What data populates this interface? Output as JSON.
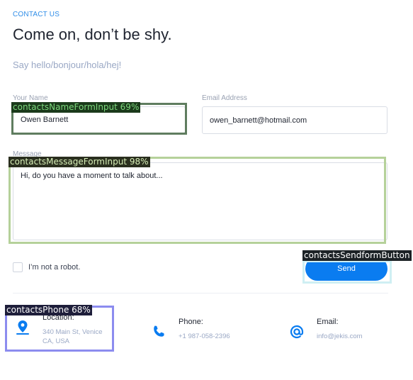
{
  "header": {
    "kicker": "CONTACT US",
    "title": "Come on, don’t be shy.",
    "subtitle": "Say hello/bonjour/hola/hej!"
  },
  "form": {
    "name_label": "Your Name",
    "name_value": "Owen Barnett",
    "email_label": "Email Address",
    "email_value": "owen_barnett@hotmail.com",
    "message_label": "Message",
    "message_value": "Hi, do you have a moment to talk about...",
    "robot_label": "I’m not a robot.",
    "send_label": "Send"
  },
  "contacts": {
    "location": {
      "label": "Location:",
      "value": "340 Main St, Venice CA, USA",
      "icon": "location-pin-icon"
    },
    "phone": {
      "label": "Phone:",
      "value": "+1 987-058-2396",
      "icon": "phone-icon"
    },
    "email": {
      "label": "Email:",
      "value": "info@jekis.com",
      "icon": "at-sign-icon"
    }
  },
  "overlays": {
    "name_tag": "contactsNameFormInput 69%",
    "message_tag": "contactsMessageFormInput 98%",
    "send_tag": "contactsSendformButton",
    "phone_tag": "contactsPhone 68%"
  },
  "colors": {
    "accent": "#0a7cf0",
    "name_overlay": "#5f7d5f",
    "message_overlay": "#b5d19a",
    "send_overlay": "#cfeff3",
    "phone_overlay": "#8c8cef"
  }
}
